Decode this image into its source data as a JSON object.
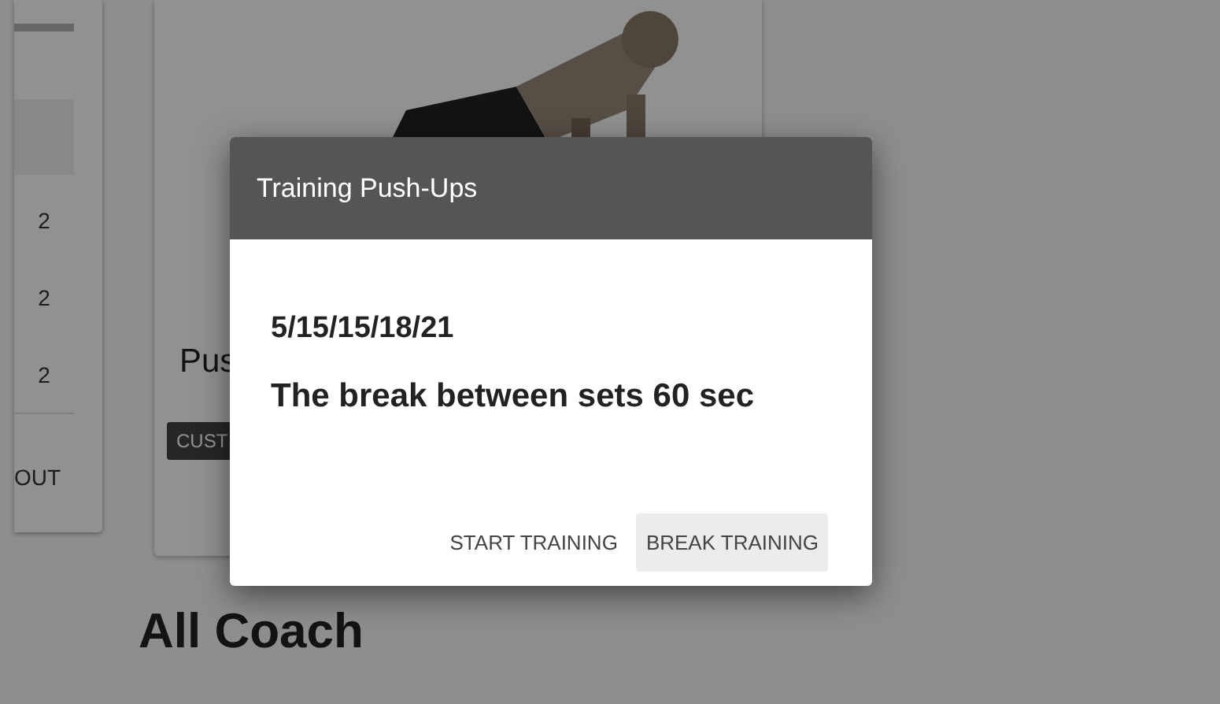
{
  "sidebar_card": {
    "rows": [
      {
        "value": "2"
      },
      {
        "value": "2"
      },
      {
        "value": "2"
      }
    ],
    "footer_link": "OUT"
  },
  "exercise_card": {
    "title": "Pus",
    "button": "CUST"
  },
  "section_heading": "All Coach",
  "dialog": {
    "title": "Training Push-Ups",
    "sets": "5/15/15/18/21",
    "break_text": "The break between sets 60 sec",
    "actions": [
      {
        "label": "START TRAINING",
        "focused": false
      },
      {
        "label": "BREAK TRAINING",
        "focused": true
      }
    ]
  }
}
